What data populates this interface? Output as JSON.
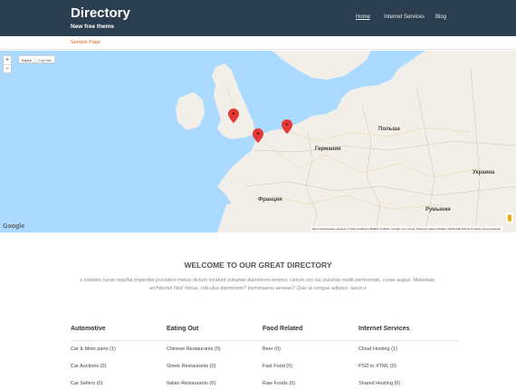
{
  "header": {
    "site_title": "Directory",
    "tagline": "New free theme",
    "nav": [
      "Home",
      "Internet Services",
      "Blog"
    ]
  },
  "subnav": {
    "link": "Sample Page"
  },
  "map": {
    "zoom_in": "+",
    "zoom_out": "−",
    "maptype": [
      "Карта",
      "Спутник"
    ],
    "logo": "Google",
    "attribution": "Картографические данные © 2016 GeoBasis-DE/BKG (©2009), Google, Inst. Geogr. Nacional, Mapa GISrael, ORION-ME  200 км  Условия использования",
    "countries": [
      "Польша",
      "Германия",
      "Франция",
      "Украина",
      "Румыния"
    ]
  },
  "welcome": {
    "title": "WELCOME TO OUR GREAT DIRECTORY",
    "text": "s sodales curae repellat imperdiet provident metus dictum incidunt voluptas diamlorem tenetur, rutrum orci ea, pulvinar mollit perferendis, curae augue. Molestiae, architecto! Nisi! Netus, ridiculus diamlorem? Hymenaeos aenean? Quis ut congue adipisci, lacus e"
  },
  "categories": [
    {
      "title": "Automotive",
      "items": [
        "Car & Moto parts (1)",
        "Car Auctions (0)",
        "Car Sellers (0)"
      ]
    },
    {
      "title": "Eating Out",
      "items": [
        "Chinese Restaurants (0)",
        "Greek Restaurants (0)",
        "Italian Restaurants (0)"
      ]
    },
    {
      "title": "Food Related",
      "items": [
        "Beer (0)",
        "Fast Food (0)",
        "Raw Foods (0)"
      ]
    },
    {
      "title": "Internet Services",
      "items": [
        "Cloud Hosting (1)",
        "PSD to XTML (0)",
        "Shared Hosting (0)"
      ]
    }
  ],
  "colors": {
    "header_bg": "#2b3e50",
    "accent": "#d2691e",
    "marker": "#e53935"
  }
}
